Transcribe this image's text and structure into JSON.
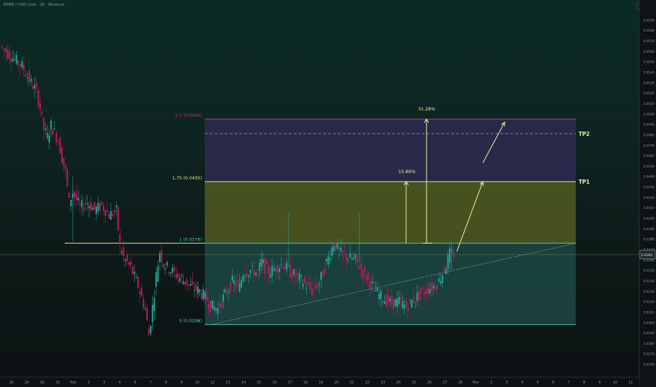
{
  "header": {
    "title": "EDEN / USD Coin · 2h · Binance",
    "currency": "USDC"
  },
  "colors": {
    "up": "#26a69a",
    "down": "#c2185b",
    "fib_line_yellow": "#f0ea8a",
    "fib_line_teal": "#3fd0b8",
    "fib_line_pink": "#d02a7a",
    "zone_teal": "#1f4e4a",
    "zone_olive": "#5a6322",
    "zone_purple": "#2e2a52",
    "arrow": "#f4f1a0"
  },
  "chart_data": {
    "type": "candlestick",
    "y_axis": {
      "ylim": [
        0.026,
        0.0595
      ],
      "tick_labels": [
        "0.0590",
        "0.0580",
        "0.0570",
        "0.0560",
        "0.0550",
        "0.0540",
        "0.0530",
        "0.0520",
        "0.0510",
        "0.0500",
        "0.0490",
        "0.0480",
        "0.0470",
        "0.0460",
        "0.0450",
        "0.0440",
        "0.0430",
        "0.0420",
        "0.0410",
        "0.0400",
        "0.0390",
        "0.0380",
        "0.0370",
        "0.0360",
        "0.0350",
        "0.0340",
        "0.0330",
        "0.0320",
        "0.0310",
        "0.0300",
        "0.0290",
        "0.0280",
        "0.0270",
        "0.0260"
      ],
      "current_price": "0.0365"
    },
    "x_axis": {
      "labels": [
        "28",
        "29",
        "30",
        "31",
        "Feb",
        "2",
        "3",
        "4",
        "6",
        "7",
        "8",
        "9",
        "10",
        "12",
        "13",
        "14",
        "15",
        "16",
        "17",
        "18",
        "19",
        "20",
        "21",
        "22",
        "23",
        "24",
        "25",
        "26",
        "27",
        "28",
        "Mar",
        "2",
        "3",
        "4",
        "5",
        "6",
        "7",
        "8",
        "9",
        "10",
        "11"
      ]
    },
    "price_path": [
      [
        0,
        0.0565
      ],
      [
        2,
        0.0558
      ],
      [
        4,
        0.0552
      ],
      [
        6,
        0.0546
      ],
      [
        8,
        0.0532
      ],
      [
        10,
        0.0522
      ],
      [
        11,
        0.0505
      ],
      [
        12,
        0.0485
      ],
      [
        13,
        0.0478
      ],
      [
        14,
        0.0489
      ],
      [
        15,
        0.0482
      ],
      [
        16,
        0.0474
      ],
      [
        17,
        0.0458
      ],
      [
        18,
        0.0444
      ],
      [
        19,
        0.0415
      ],
      [
        20,
        0.0425
      ],
      [
        22,
        0.041
      ],
      [
        24,
        0.0415
      ],
      [
        26,
        0.0408
      ],
      [
        28,
        0.0412
      ],
      [
        30,
        0.0403
      ],
      [
        32,
        0.0407
      ],
      [
        33,
        0.0372
      ],
      [
        34,
        0.0362
      ],
      [
        36,
        0.0352
      ],
      [
        38,
        0.0335
      ],
      [
        40,
        0.0312
      ],
      [
        41,
        0.0288
      ],
      [
        42,
        0.0315
      ],
      [
        43,
        0.0345
      ],
      [
        44,
        0.0368
      ],
      [
        45,
        0.0356
      ],
      [
        47,
        0.035
      ],
      [
        49,
        0.0344
      ],
      [
        51,
        0.0339
      ],
      [
        53,
        0.0333
      ],
      [
        55,
        0.033
      ],
      [
        57,
        0.0322
      ],
      [
        58,
        0.0316
      ],
      [
        60,
        0.0313
      ],
      [
        62,
        0.0327
      ],
      [
        64,
        0.0339
      ],
      [
        66,
        0.0334
      ],
      [
        67,
        0.0348
      ],
      [
        69,
        0.035
      ],
      [
        71,
        0.0347
      ],
      [
        72,
        0.0358
      ],
      [
        74,
        0.0348
      ],
      [
        76,
        0.0352
      ],
      [
        78,
        0.0356
      ],
      [
        80,
        0.0348
      ],
      [
        82,
        0.0343
      ],
      [
        84,
        0.0337
      ],
      [
        86,
        0.033
      ],
      [
        88,
        0.0338
      ],
      [
        90,
        0.0358
      ],
      [
        92,
        0.0376
      ],
      [
        94,
        0.0366
      ],
      [
        96,
        0.0362
      ],
      [
        98,
        0.036
      ],
      [
        100,
        0.0348
      ],
      [
        102,
        0.0338
      ],
      [
        104,
        0.0328
      ],
      [
        106,
        0.0322
      ],
      [
        108,
        0.0318
      ],
      [
        110,
        0.032
      ],
      [
        112,
        0.0315
      ],
      [
        114,
        0.0322
      ],
      [
        116,
        0.0328
      ],
      [
        118,
        0.0332
      ],
      [
        120,
        0.0336
      ],
      [
        121,
        0.034
      ],
      [
        122,
        0.0347
      ],
      [
        123,
        0.0355
      ],
      [
        124,
        0.0366
      ]
    ],
    "fib_levels": [
      {
        "ratio_label": "2.5 (0.0495)",
        "value": 0.0495,
        "color": "pink"
      },
      {
        "ratio_label": "1.75 (0.0435)",
        "value": 0.0435,
        "color": "yellow"
      },
      {
        "ratio_label": "1 (0.0376)",
        "value": 0.0376,
        "color": "teal"
      },
      {
        "ratio_label": "0 (0.0298)",
        "value": 0.0298,
        "color": "teal"
      }
    ],
    "targets": [
      {
        "label": "TP2",
        "value": 0.0481
      },
      {
        "label": "TP1",
        "value": 0.0435
      }
    ],
    "annotations": [
      {
        "text": "15.89%",
        "from": 0.0376,
        "to": 0.0435
      },
      {
        "text": "31.28%",
        "from": 0.0376,
        "to": 0.0495
      }
    ],
    "support_level": 0.0376,
    "trendline": {
      "from": 0.0298,
      "to": 0.0376
    }
  }
}
